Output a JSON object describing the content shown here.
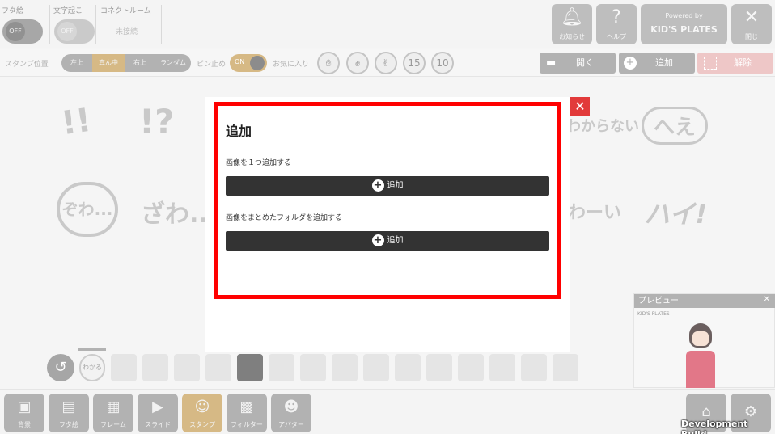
{
  "topbar": {
    "toggles": [
      {
        "label": "フタ絵",
        "state": "OFF"
      },
      {
        "label": "文字起こ",
        "state": "OFF"
      }
    ],
    "connect_room": {
      "label": "コネクトルーム",
      "status": "未接続"
    },
    "buttons": {
      "notifications": {
        "label": "お知らせ",
        "icon": "bell-icon"
      },
      "help": {
        "label": "ヘルプ",
        "icon": "question-icon"
      },
      "kids_plates": {
        "powered_by": "Powered by",
        "brand": "KID'S PLATES"
      },
      "close": {
        "label": "閉じ",
        "icon": "close-icon"
      }
    }
  },
  "stampbar": {
    "position_label": "スタンプ位置",
    "positions": [
      "左上",
      "真ん中",
      "右上",
      "ランダム"
    ],
    "selected_position": "真ん中",
    "pin_label": "ピン止め",
    "pin_state": "ON",
    "favorites_label": "お気に入り",
    "favorites": [
      "hand-icon",
      "rock-icon",
      "peace-icon",
      "15",
      "10"
    ],
    "open_label": "開く",
    "add_label": "追加",
    "remove_label": "解除"
  },
  "stamps": [
    "!!",
    "!?",
    "わからない",
    "へえ",
    "ぞわ...",
    "ざわ...",
    "わーい",
    "ハイ!"
  ],
  "thumbnails": [
    "わかる"
  ],
  "bottombar": {
    "items": [
      {
        "label": "背景",
        "icon": "image-icon"
      },
      {
        "label": "フタ絵",
        "icon": "frame-icon"
      },
      {
        "label": "フレーム",
        "icon": "film-icon"
      },
      {
        "label": "スライド",
        "icon": "play-icon"
      },
      {
        "label": "スタンプ",
        "icon": "smile-icon"
      },
      {
        "label": "フィルター",
        "icon": "clapper-icon"
      },
      {
        "label": "アバター",
        "icon": "avatar-icon"
      }
    ],
    "shop_icon": "shop-icon",
    "settings_icon": "gear-icon"
  },
  "preview": {
    "title": "プレビュー",
    "brand": "KID'S PLATES"
  },
  "modal": {
    "title": "追加",
    "single_desc": "画像を１つ追加する",
    "single_button": "追加",
    "folder_desc": "画像をまとめたフォルダを追加する",
    "folder_button": "追加"
  },
  "dev_build": "Development Build",
  "colors": {
    "highlight": "#ff0000",
    "modal_button": "#333333",
    "close_button": "#e23a3a"
  }
}
